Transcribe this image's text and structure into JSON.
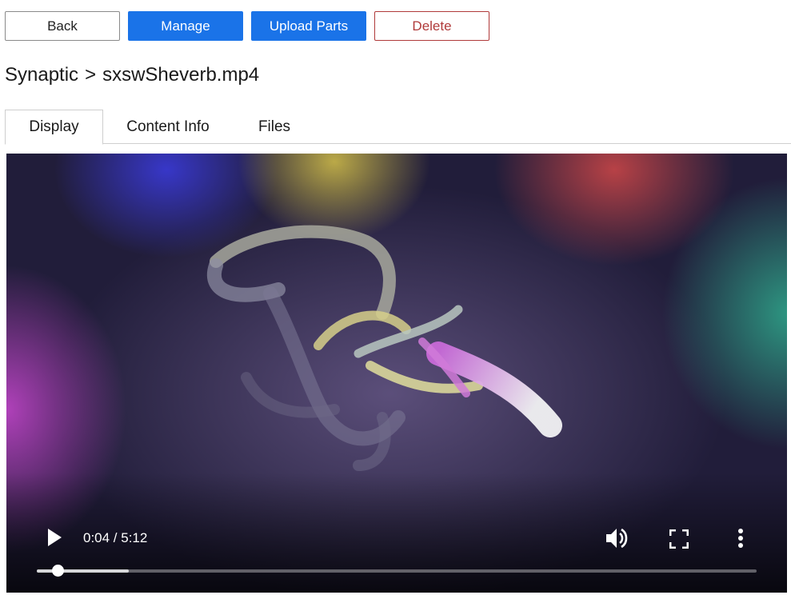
{
  "toolbar": {
    "back_label": "Back",
    "manage_label": "Manage",
    "upload_label": "Upload Parts",
    "delete_label": "Delete"
  },
  "breadcrumb": {
    "parent": "Synaptic",
    "separator": ">",
    "current": "sxswSheverb.mp4"
  },
  "tabs": [
    {
      "label": "Display",
      "active": true
    },
    {
      "label": "Content Info",
      "active": false
    },
    {
      "label": "Files",
      "active": false
    }
  ],
  "player": {
    "time_display": "0:04 / 5:12",
    "played_fraction": 0.0128,
    "buffered_fraction": 0.128,
    "icons": {
      "play": "play-icon",
      "volume": "volume-icon",
      "fullscreen": "fullscreen-icon",
      "more": "more-options-icon"
    }
  },
  "colors": {
    "primary": "#1a73e8",
    "danger": "#b03a3a"
  }
}
